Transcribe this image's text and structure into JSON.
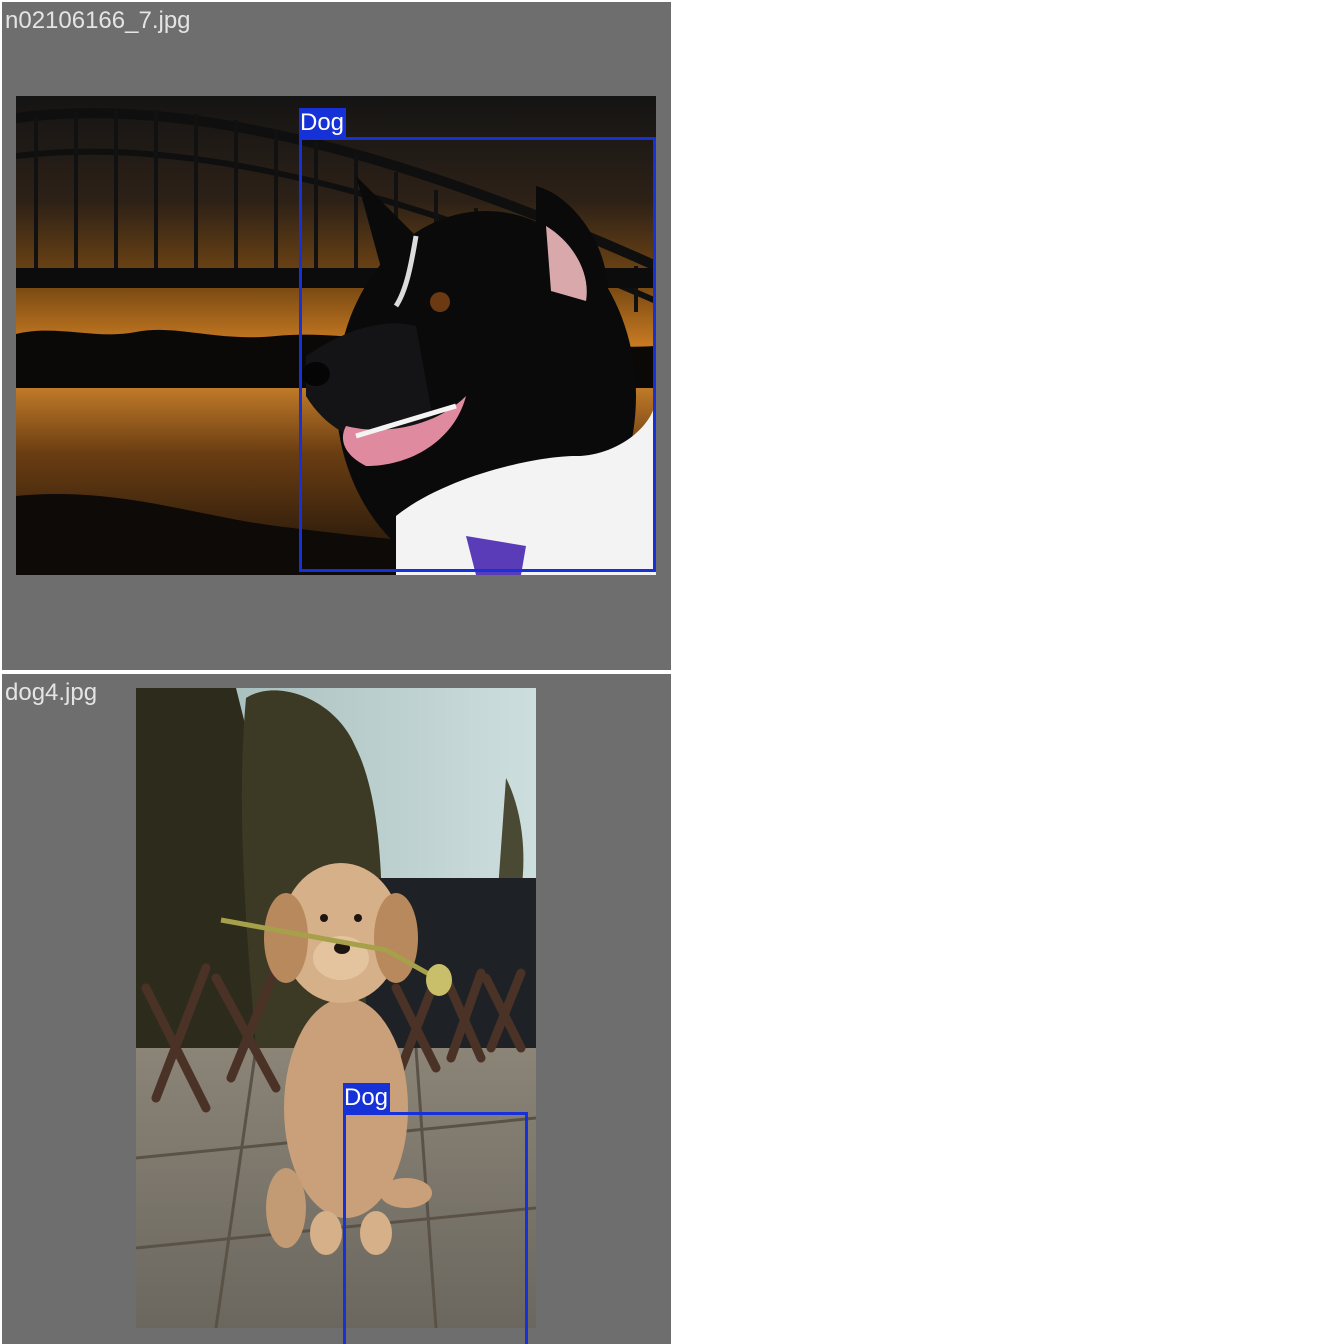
{
  "tiles": [
    {
      "filename": "n02106166_7.jpg",
      "detections": [
        {
          "label": "Dog"
        }
      ],
      "scene": "dog-by-river-at-sunset"
    },
    {
      "filename": "dog4.jpg",
      "detections": [
        {
          "label": "Dog"
        }
      ],
      "scene": "puppy-holding-flower"
    }
  ],
  "colors": {
    "tile_background": "#6e6e6e",
    "canvas_background": "#ffffff",
    "filename_text": "#e4e4e4",
    "box_color": "#1631d8",
    "box_label_text": "#ffffff"
  }
}
